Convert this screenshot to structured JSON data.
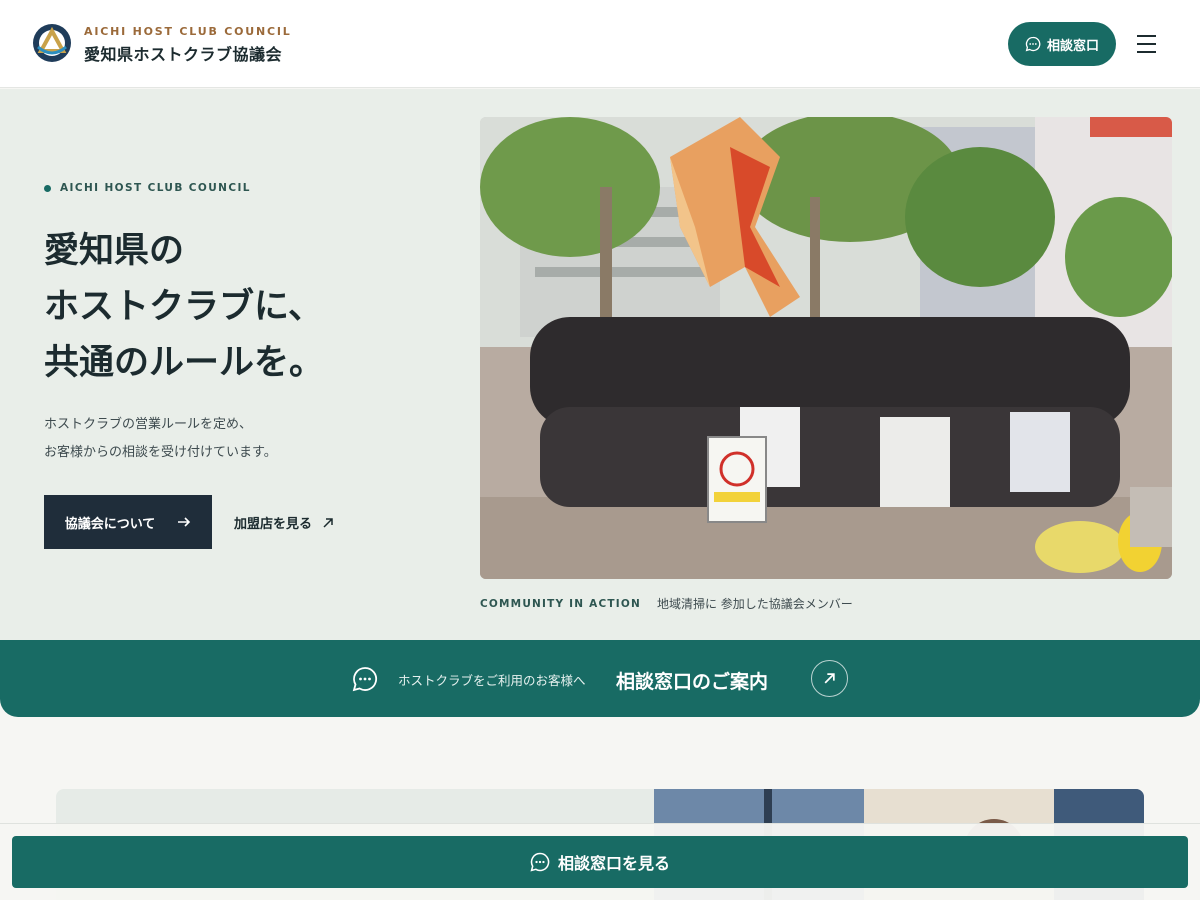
{
  "header": {
    "brand_en": "AICHI HOST CLUB COUNCIL",
    "brand_jp": "愛知県ホストクラブ協議会",
    "consult_label": "相談窓口",
    "menu_icon": "hamburger-menu-icon"
  },
  "hero": {
    "eyebrow": "AICHI HOST CLUB COUNCIL",
    "headline": [
      "愛知県の",
      "ホストクラブに、",
      "共通のルールを。"
    ],
    "lead": [
      "ホストクラブの営業ルールを定め、",
      "お客様からの相談を受け付けています。"
    ],
    "about_button": "協議会について",
    "member_link": "加盟店を見る",
    "caption_en": "COMMUNITY IN ACTION",
    "caption_jp": "地域清掃に 参加した協議会メンバー"
  },
  "band": {
    "small": "ホストクラブをご利用のお客様へ",
    "title": "相談窓口のご案内"
  },
  "sticky": {
    "label": "相談窓口を見る"
  },
  "colors": {
    "accent": "#186b64",
    "dark": "#1f2d3a",
    "brand_gold": "#9b6a3a",
    "hero_bg": "#e9eee9"
  }
}
